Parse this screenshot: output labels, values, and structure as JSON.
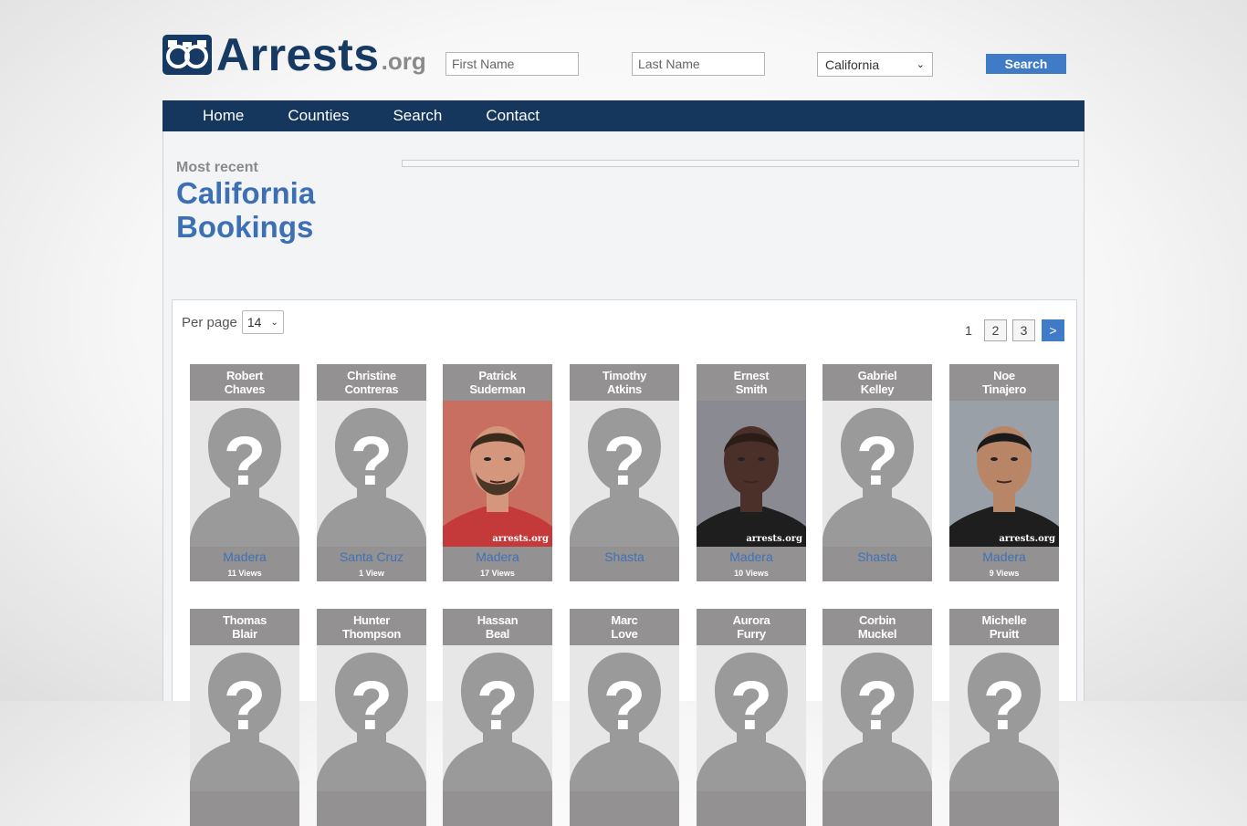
{
  "header": {
    "logo_text": "Arrests",
    "logo_tld": ".org",
    "first_name_placeholder": "First Name",
    "last_name_placeholder": "Last Name",
    "state_selected": "California",
    "search_label": "Search"
  },
  "nav": {
    "items": [
      "Home",
      "Counties",
      "Search",
      "Contact"
    ]
  },
  "page": {
    "subheading": "Most recent",
    "title_line1": "California",
    "title_line2": "Bookings"
  },
  "listing": {
    "per_page_label": "Per page",
    "per_page_value": "14",
    "pages": [
      "1",
      "2",
      "3"
    ],
    "next_label": ">"
  },
  "people": [
    {
      "first": "Robert",
      "last": "Chaves",
      "county": "Madera",
      "views": "11 Views",
      "photo": "placeholder"
    },
    {
      "first": "Christine",
      "last": "Contreras",
      "county": "Santa Cruz",
      "views": "1 View",
      "photo": "placeholder"
    },
    {
      "first": "Patrick",
      "last": "Suderman",
      "county": "Madera",
      "views": "17 Views",
      "photo": "mugshot",
      "watermark": "arrests.org"
    },
    {
      "first": "Timothy",
      "last": "Atkins",
      "county": "Shasta",
      "views": "",
      "photo": "placeholder"
    },
    {
      "first": "Ernest",
      "last": "Smith",
      "county": "Madera",
      "views": "10 Views",
      "photo": "mugshot",
      "watermark": "arrests.org"
    },
    {
      "first": "Gabriel",
      "last": "Kelley",
      "county": "Shasta",
      "views": "",
      "photo": "placeholder"
    },
    {
      "first": "Noe",
      "last": "Tinajero",
      "county": "Madera",
      "views": "9 Views",
      "photo": "mugshot",
      "watermark": "arrests.org"
    },
    {
      "first": "Thomas",
      "last": "Blair",
      "county": "",
      "views": "",
      "photo": "placeholder"
    },
    {
      "first": "Hunter",
      "last": "Thompson",
      "county": "",
      "views": "",
      "photo": "placeholder"
    },
    {
      "first": "Hassan",
      "last": "Beal",
      "county": "",
      "views": "",
      "photo": "placeholder"
    },
    {
      "first": "Marc",
      "last": "Love",
      "county": "",
      "views": "",
      "photo": "placeholder"
    },
    {
      "first": "Aurora",
      "last": "Furry",
      "county": "",
      "views": "",
      "photo": "placeholder"
    },
    {
      "first": "Corbin",
      "last": "Muckel",
      "county": "",
      "views": "",
      "photo": "placeholder"
    },
    {
      "first": "Michelle",
      "last": "Pruitt",
      "county": "",
      "views": "",
      "photo": "placeholder"
    }
  ],
  "colors": {
    "brand_navy": "#15375e",
    "accent_blue": "#3f7bc6",
    "link_blue": "#3f72b8",
    "card_gray": "#949192"
  }
}
